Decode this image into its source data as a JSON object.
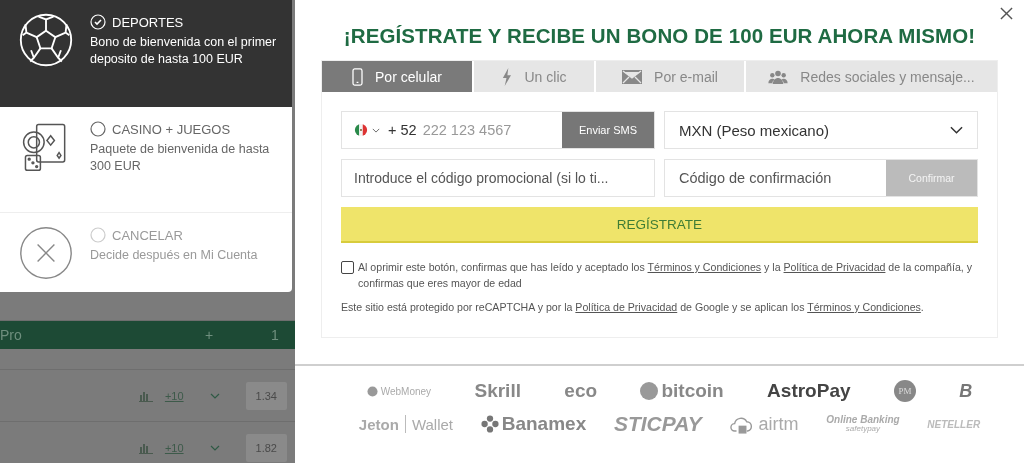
{
  "bonus_options": [
    {
      "title": "DEPORTES",
      "description": "Bono de bienvenida con el primer deposito de hasta 100 EUR",
      "selected": true
    },
    {
      "title": "CASINO + JUEGOS",
      "description": "Paquete de bienvenida de hasta 300 EUR",
      "selected": false
    },
    {
      "title": "CANCELAR",
      "description": "Decide después en Mi Cuenta",
      "selected": false
    }
  ],
  "background": {
    "league": {
      "name": "Pro",
      "plus": "+",
      "column": "1"
    },
    "rows": [
      {
        "more": "+10",
        "odd": "1.34"
      },
      {
        "more": "+10",
        "odd": "1.82"
      }
    ]
  },
  "modal": {
    "title": "¡REGÍSTRATE Y RECIBE UN BONO DE 100 EUR AHORA MISMO!",
    "tabs": [
      {
        "label": "Por celular",
        "selected": true
      },
      {
        "label": "Un clic",
        "selected": false
      },
      {
        "label": "Por e-mail",
        "selected": false
      },
      {
        "label": "Redes sociales y mensaje...",
        "selected": false
      }
    ],
    "phone": {
      "prefix": "+ 52",
      "placeholder": "222 123 4567",
      "button": "Enviar SMS"
    },
    "currency": {
      "value": "MXN (Peso mexicano)"
    },
    "promo": {
      "placeholder": "Introduce el código promocional (si lo ti..."
    },
    "confirmation": {
      "placeholder": "Código de confirmación",
      "button": "Confirmar"
    },
    "register_button": "REGÍSTRATE",
    "consent": {
      "checked": false,
      "parts": [
        {
          "text": "Al oprimir este botón, confirmas que has leído y aceptado los ",
          "kind": "text"
        },
        {
          "text": "Términos y Condiciones",
          "kind": "link"
        },
        {
          "text": " y la ",
          "kind": "text"
        },
        {
          "text": "Política de Privacidad",
          "kind": "link"
        },
        {
          "text": " de la compañía, y confirmas que eres mayor de edad",
          "kind": "text"
        }
      ]
    },
    "recaptcha": [
      {
        "text": "Este sitio está protegido por reCAPTCHA y por la ",
        "kind": "text"
      },
      {
        "text": "Política de Privacidad",
        "kind": "link"
      },
      {
        "text": " de Google y se aplican los ",
        "kind": "text"
      },
      {
        "text": "Términos y Condiciones",
        "kind": "link"
      },
      {
        "text": ".",
        "kind": "text"
      }
    ]
  },
  "payment_logos": [
    [
      {
        "text": "WebMoney",
        "kind": "light"
      },
      {
        "text": "Skrill",
        "kind": "heavy"
      },
      {
        "text": "eco",
        "kind": "heavy"
      },
      {
        "text": "bitcoin",
        "kind": "heavy"
      },
      {
        "text": "AstroPay",
        "kind": "dark"
      },
      {
        "text": "PM",
        "kind": "badge"
      },
      {
        "text": "B",
        "kind": "mark"
      }
    ],
    [
      {
        "text": "Jeton",
        "text2": "Wallet",
        "kind": "split"
      },
      {
        "text": "Banamex",
        "kind": "heavy"
      },
      {
        "text": "STICPAY",
        "kind": "italic"
      },
      {
        "text": "airtm",
        "kind": "thin"
      },
      {
        "text": "Online Banking",
        "text2": "safetypay",
        "kind": "stack"
      },
      {
        "text": "NETELLER",
        "kind": "tiny"
      }
    ]
  ]
}
